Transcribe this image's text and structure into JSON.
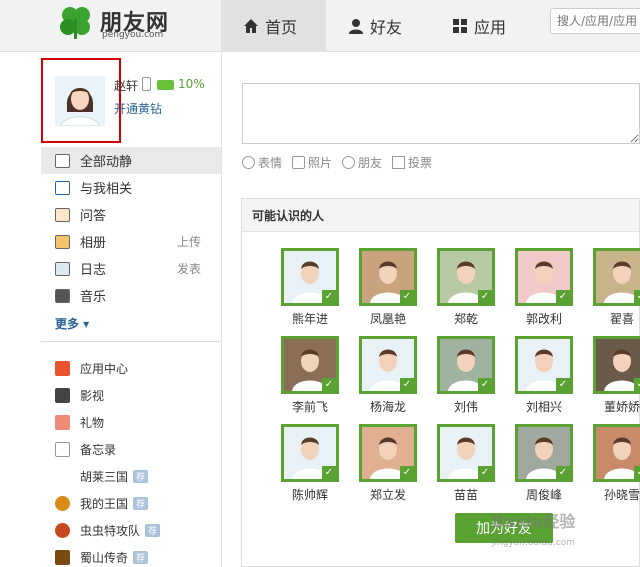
{
  "header": {
    "logo_text": "朋友网",
    "logo_sub": "pengyou.com",
    "nav": [
      {
        "label": "首页"
      },
      {
        "label": "好友"
      },
      {
        "label": "应用"
      }
    ],
    "search_placeholder": "搜人/应用/应用"
  },
  "profile": {
    "name": "赵轩",
    "percent": "10%",
    "open_vip": "开通黄钻"
  },
  "menu": {
    "items": [
      {
        "label": "全部动静",
        "action": ""
      },
      {
        "label": "与我相关",
        "action": ""
      },
      {
        "label": "问答",
        "action": ""
      },
      {
        "label": "相册",
        "action": "上传"
      },
      {
        "label": "日志",
        "action": "发表"
      },
      {
        "label": "音乐",
        "action": ""
      }
    ],
    "more": "更多 ▾"
  },
  "apps": {
    "items": [
      {
        "label": "应用中心",
        "badge": ""
      },
      {
        "label": "影视",
        "badge": ""
      },
      {
        "label": "礼物",
        "badge": ""
      },
      {
        "label": "备忘录",
        "badge": ""
      },
      {
        "label": "胡莱三国",
        "badge": "荐"
      },
      {
        "label": "我的王国",
        "badge": "荐"
      },
      {
        "label": "虫虫特攻队",
        "badge": "荐"
      },
      {
        "label": "蜀山传奇",
        "badge": "荐"
      }
    ]
  },
  "composer": {
    "tools": [
      {
        "label": "表情"
      },
      {
        "label": "照片"
      },
      {
        "label": "朋友"
      },
      {
        "label": "投票"
      }
    ]
  },
  "people": {
    "title": "可能认识的人",
    "list": [
      {
        "name": "熊年进"
      },
      {
        "name": "凤凰艳"
      },
      {
        "name": "郑乾"
      },
      {
        "name": "郭改利"
      },
      {
        "name": "翟喜"
      },
      {
        "name": "李前飞"
      },
      {
        "name": "杨海龙"
      },
      {
        "name": "刘伟"
      },
      {
        "name": "刘相兴"
      },
      {
        "name": "董娇娇"
      },
      {
        "name": "陈帅辉"
      },
      {
        "name": "郑立发"
      },
      {
        "name": "苗苗"
      },
      {
        "name": "周俊峰"
      },
      {
        "name": "孙晓雪"
      }
    ],
    "add_button": "加为好友"
  },
  "watermark": {
    "text": "Baidu经验",
    "sub": "jingyan.baidu.com"
  },
  "colors": {
    "accent_green": "#5aa232",
    "link_blue": "#2a6496",
    "highlight_red": "#d40000"
  }
}
